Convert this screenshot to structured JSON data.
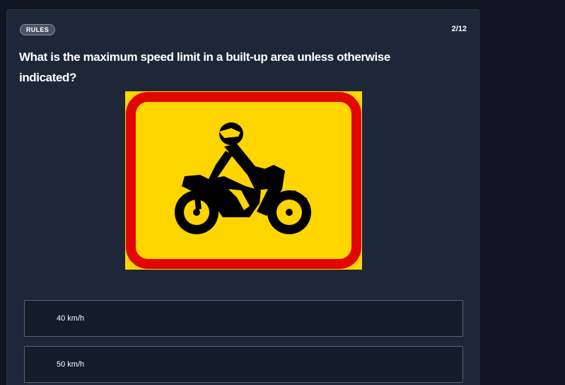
{
  "header": {
    "badge": "RULES",
    "counter": "2/12"
  },
  "question": {
    "text": "What is the maximum speed limit in a built-up area unless otherwise indicated?"
  },
  "sign": {
    "icon": "motorcycle-warning-sign",
    "colors": {
      "background": "#ffd500",
      "border": "#e10600",
      "figure": "#000000"
    }
  },
  "options": [
    {
      "label": "40 km/h"
    },
    {
      "label": "50 km/h"
    }
  ],
  "colors": {
    "page_background": "#0f1522",
    "card_background": "#1e2738",
    "option_background": "#141b29",
    "option_border": "#5a6272",
    "badge_background": "#4a5263"
  }
}
